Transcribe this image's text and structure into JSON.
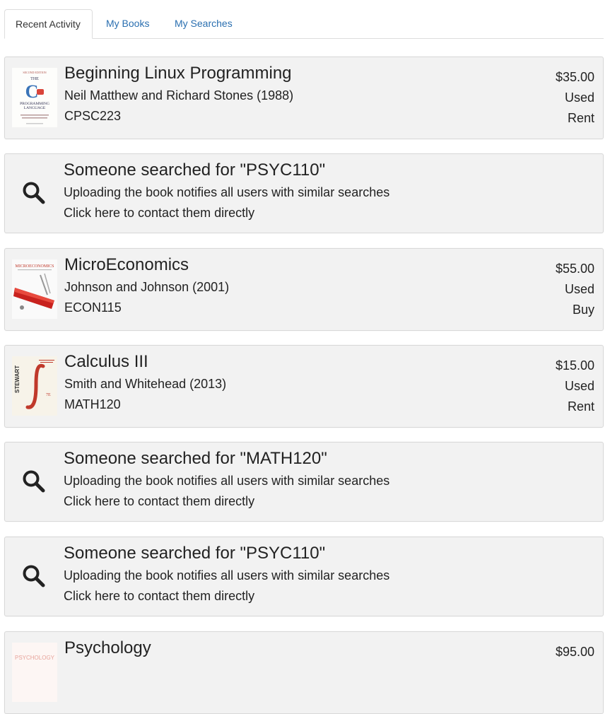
{
  "tabs": [
    {
      "label": "Recent Activity",
      "active": true
    },
    {
      "label": "My Books",
      "active": false
    },
    {
      "label": "My Searches",
      "active": false
    }
  ],
  "feed": [
    {
      "type": "book",
      "title": "Beginning Linux Programming",
      "authors": "Neil Matthew and Richard Stones (1988)",
      "course": "CPSC223",
      "price": "$35.00",
      "condition": "Used",
      "offer": "Rent",
      "cover": "c-programming-language-cover"
    },
    {
      "type": "search",
      "title": "Someone searched for \"PSYC110\"",
      "line1": "Uploading the book notifies all users with similar searches",
      "line2": "Click here to contact them directly",
      "icon": "search-icon"
    },
    {
      "type": "book",
      "title": "MicroEconomics",
      "authors": "Johnson and Johnson (2001)",
      "course": "ECON115",
      "price": "$55.00",
      "condition": "Used",
      "offer": "Buy",
      "cover": "microeconomics-cover"
    },
    {
      "type": "book",
      "title": "Calculus III",
      "authors": "Smith and Whitehead (2013)",
      "course": "MATH120",
      "price": "$15.00",
      "condition": "Used",
      "offer": "Rent",
      "cover": "stewart-calculus-cover"
    },
    {
      "type": "search",
      "title": "Someone searched for \"MATH120\"",
      "line1": "Uploading the book notifies all users with similar searches",
      "line2": "Click here to contact them directly",
      "icon": "search-icon"
    },
    {
      "type": "search",
      "title": "Someone searched for \"PSYC110\"",
      "line1": "Uploading the book notifies all users with similar searches",
      "line2": "Click here to contact them directly",
      "icon": "search-icon"
    },
    {
      "type": "book",
      "title": "Psychology",
      "price": "$95.00",
      "cover": "psychology-cover"
    }
  ],
  "cover_text": {
    "c_book": [
      "SECOND EDITION",
      "THE",
      "C",
      "PROGRAMMING",
      "LANGUAGE"
    ],
    "micro": "MICROECONOMICS",
    "stewart": "STEWART",
    "stewart_ed": "7E",
    "psych": "PSYCHOLOGY"
  },
  "colors": {
    "link": "#2a6fb0",
    "card_bg": "#f2f2f2",
    "card_border": "#d8d8d8"
  }
}
